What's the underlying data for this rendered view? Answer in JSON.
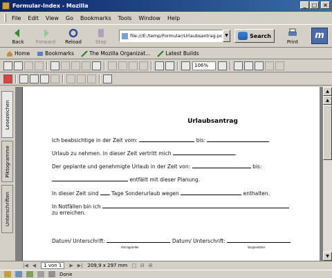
{
  "window": {
    "title": "Formular-Index - Mozilla"
  },
  "menubar": {
    "items": [
      "File",
      "Edit",
      "View",
      "Go",
      "Bookmarks",
      "Tools",
      "Window",
      "Help"
    ]
  },
  "navbar": {
    "back": "Back",
    "forward": "Forward",
    "reload": "Reload",
    "stop": "Stop",
    "url": "file:///E:/temp/Formular/Urlaubsantrag.pd",
    "search": "Search",
    "print": "Print"
  },
  "bookmarks": {
    "items": [
      "Home",
      "Bookmarks",
      "The Mozilla Organizat...",
      "Latest Builds"
    ]
  },
  "acrobat": {
    "zoom": "106%"
  },
  "sidetabs": [
    "Lesezeichen",
    "Piktogramme",
    "Unterschriften"
  ],
  "document": {
    "heading": "Urlaubsantrag",
    "line1_a": "Ich beabsichtige in der Zeit vom:",
    "line1_b": "bis:",
    "line2": "Urlaub zu nehmen. In dieser Zeit vertritt mich",
    "line3_a": "Der geplante und genehmigte Urlaub in der Zeit von:",
    "line3_b": "bis:",
    "line4": "entfällt mit dieser Planung.",
    "line5_a": "In dieser Zeit sind",
    "line5_b": "Tage Sonderurlaub wegen",
    "line5_c": "enthalten.",
    "line6": "In Notfällen bin ich",
    "line7": "zu erreichen.",
    "sign_a": "Datum/ Unterschrift:",
    "sign_b": "Datum/ Unterschrift:",
    "sub_a": "Antragsteller",
    "sub_b": "Vorgesetzter"
  },
  "pagebar": {
    "page": "1 von 1",
    "size": "209,9 x 297 mm"
  },
  "status": {
    "text": "Done"
  },
  "colors": {
    "titlebar": "#0a246a",
    "face": "#d4d0c8",
    "workspace": "#808080"
  }
}
